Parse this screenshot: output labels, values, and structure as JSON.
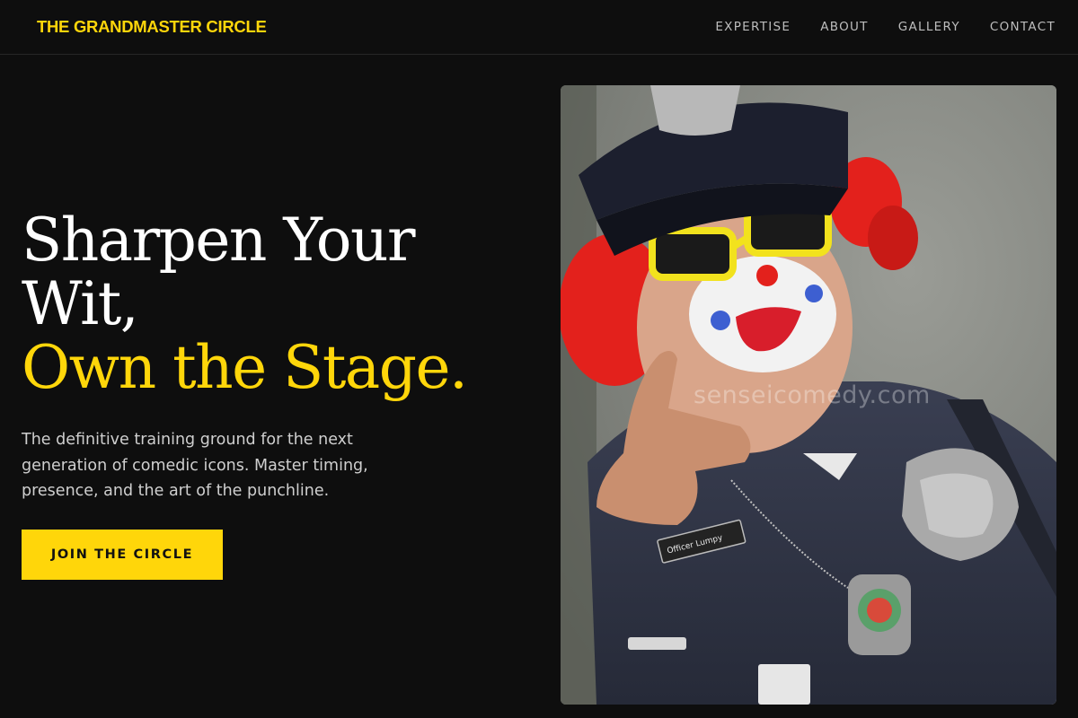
{
  "header": {
    "brand": "THE GRANDMASTER CIRCLE",
    "nav": [
      "EXPERTISE",
      "ABOUT",
      "GALLERY",
      "CONTACT"
    ]
  },
  "hero": {
    "headline_line1": "Sharpen Your Wit,",
    "headline_line2": "Own the Stage.",
    "subtitle": "The definitive training ground for the next generation of comedic icons. Master timing, presence, and the art of the punchline.",
    "cta_label": "JOIN THE CIRCLE"
  },
  "photo": {
    "watermark": "senseicomedy.com",
    "nametag": "Officer Lumpy"
  },
  "colors": {
    "accent": "#ffd60a",
    "background": "#0e0e0e",
    "text": "#ffffff",
    "muted": "#cfcfcf"
  }
}
